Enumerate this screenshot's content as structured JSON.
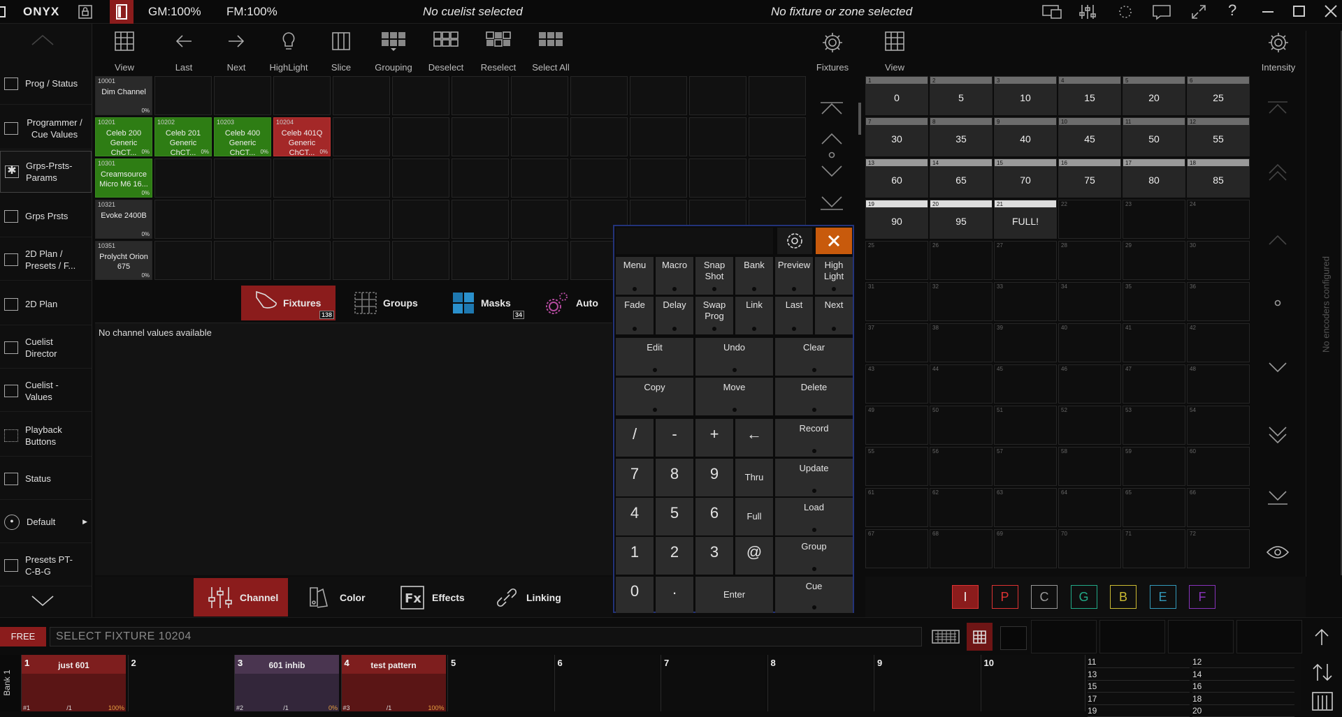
{
  "topbar": {
    "brand": "ONYX",
    "gm": "GM:100%",
    "fm": "FM:100%",
    "cuelist_status": "No cuelist selected",
    "fixture_status": "No fixture or zone selected"
  },
  "sidebar": {
    "items": [
      {
        "label": "Prog / Status"
      },
      {
        "label": "Programmer / Cue Values"
      },
      {
        "label": "Grps-Prsts-Params"
      },
      {
        "label": "Grps Prsts"
      },
      {
        "label": "2D Plan / Presets / F..."
      },
      {
        "label": "2D Plan"
      },
      {
        "label": "Cuelist Director"
      },
      {
        "label": "Cuelist - Values"
      },
      {
        "label": "Playback Buttons"
      },
      {
        "label": "Status"
      },
      {
        "label": "Default"
      },
      {
        "label": "Presets PT-C-B-G"
      }
    ]
  },
  "toolbar": {
    "view": "View",
    "last": "Last",
    "next": "Next",
    "highlight": "HighLight",
    "slice": "Slice",
    "grouping": "Grouping",
    "deselect": "Deselect",
    "reselect": "Reselect",
    "select_all": "Select All",
    "fixtures": "Fixtures",
    "view2": "View",
    "intensity": "Intensity"
  },
  "fixtures": [
    {
      "id": "10001",
      "name": "Dim Channel",
      "pct": "0%"
    },
    {
      "id": "10201",
      "name": "Celeb 200 Generic ChCT...",
      "pct": "0%"
    },
    {
      "id": "10202",
      "name": "Celeb 201 Generic ChCT...",
      "pct": "0%"
    },
    {
      "id": "10203",
      "name": "Celeb 400 Generic ChCT...",
      "pct": "0%"
    },
    {
      "id": "10204",
      "name": "Celeb 401Q Generic ChCT...",
      "pct": "0%"
    },
    {
      "id": "10301",
      "name": "Creamsource Micro M6 16...",
      "pct": "0%"
    },
    {
      "id": "10321",
      "name": "Evoke 2400B",
      "pct": "0%"
    },
    {
      "id": "10351",
      "name": "Prolycht Orion 675",
      "pct": "0%"
    }
  ],
  "tabs": {
    "fixtures": "Fixtures",
    "fixtures_count": "138",
    "groups": "Groups",
    "masks": "Masks",
    "masks_count": "34",
    "auto": "Auto"
  },
  "channel_values": {
    "empty": "No channel values available"
  },
  "bottom_tabs": {
    "channel": "Channel",
    "color": "Color",
    "effects": "Effects",
    "linking": "Linking"
  },
  "keypad": {
    "row1": [
      "Menu",
      "Macro",
      "Snap Shot",
      "Bank",
      "Preview",
      "High Light"
    ],
    "row2": [
      "Fade",
      "Delay",
      "Swap Prog",
      "Link",
      "Last",
      "Next"
    ],
    "row3": [
      "Edit",
      "Undo",
      "Clear"
    ],
    "row4": [
      "Copy",
      "Move",
      "Delete"
    ],
    "ops": [
      "/",
      "-",
      "+",
      "←"
    ],
    "n789": [
      "7",
      "8",
      "9"
    ],
    "n456": [
      "4",
      "5",
      "6"
    ],
    "n123": [
      "1",
      "2",
      "3"
    ],
    "thru": "Thru",
    "full": "Full",
    "at": "@",
    "zero": "0",
    "dot": ".",
    "enter": "Enter",
    "right": [
      "Record",
      "Update",
      "Load",
      "Group",
      "Cue"
    ]
  },
  "intensity": {
    "values": [
      "0",
      "5",
      "10",
      "15",
      "20",
      "25",
      "30",
      "35",
      "40",
      "45",
      "50",
      "55",
      "60",
      "65",
      "70",
      "75",
      "80",
      "85",
      "90",
      "95",
      "FULL!"
    ],
    "no_encoders": "No encoders configured"
  },
  "color_filters": [
    {
      "label": "I",
      "color": "#d33"
    },
    {
      "label": "P",
      "color": "#d33"
    },
    {
      "label": "C",
      "color": "#999"
    },
    {
      "label": "G",
      "color": "#2a8"
    },
    {
      "label": "B",
      "color": "#cb3"
    },
    {
      "label": "E",
      "color": "#39b"
    },
    {
      "label": "F",
      "color": "#83b"
    }
  ],
  "command": {
    "mode": "FREE",
    "line": "SELECT FIXTURE 10204"
  },
  "bank": {
    "label": "Bank 1"
  },
  "playbacks": [
    {
      "num": "1",
      "title": "just 601",
      "cue": "#1",
      "of": "/1",
      "pct": "100%"
    },
    {
      "num": "2",
      "title": ""
    },
    {
      "num": "3",
      "title": "601 inhib",
      "cue": "#2",
      "of": "/1",
      "pct": "0%"
    },
    {
      "num": "4",
      "title": "test pattern",
      "cue": "#3",
      "of": "/1",
      "pct": "100%"
    },
    {
      "num": "5"
    },
    {
      "num": "6"
    },
    {
      "num": "7"
    },
    {
      "num": "8"
    },
    {
      "num": "9"
    },
    {
      "num": "10"
    }
  ],
  "mini_playbacks": [
    "11",
    "12",
    "13",
    "14",
    "15",
    "16",
    "17",
    "18",
    "19",
    "20"
  ]
}
